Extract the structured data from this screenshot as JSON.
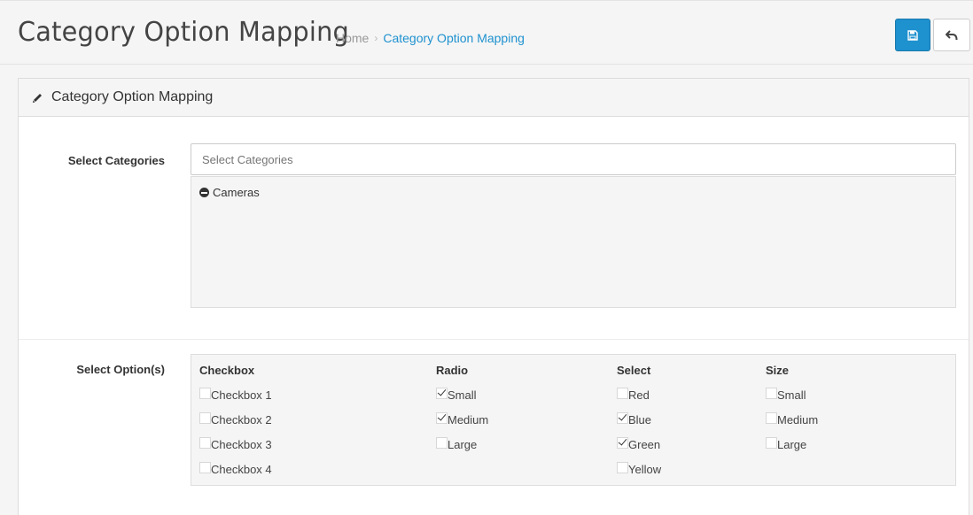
{
  "header": {
    "title": "Category Option Mapping",
    "breadcrumb": {
      "home": "Home",
      "separator": "›",
      "current": "Category Option Mapping"
    },
    "save_icon": "floppy-disk-icon",
    "back_icon": "reply-icon"
  },
  "panel": {
    "heading_icon": "pencil-icon",
    "heading": "Category Option Mapping",
    "categories": {
      "label": "Select Categories",
      "placeholder": "Select Categories",
      "selected": [
        {
          "name": "Cameras",
          "icon": "minus-circle-icon"
        }
      ]
    },
    "options": {
      "label": "Select Option(s)",
      "groups": [
        {
          "title": "Checkbox",
          "items": [
            {
              "label": "Checkbox 1",
              "checked": false
            },
            {
              "label": "Checkbox 2",
              "checked": false
            },
            {
              "label": "Checkbox 3",
              "checked": false
            },
            {
              "label": "Checkbox 4",
              "checked": false
            }
          ]
        },
        {
          "title": "Radio",
          "items": [
            {
              "label": "Small",
              "checked": true
            },
            {
              "label": "Medium",
              "checked": true
            },
            {
              "label": "Large",
              "checked": false
            }
          ]
        },
        {
          "title": "Select",
          "items": [
            {
              "label": "Red",
              "checked": false
            },
            {
              "label": "Blue",
              "checked": true
            },
            {
              "label": "Green",
              "checked": true
            },
            {
              "label": "Yellow",
              "checked": false
            }
          ]
        },
        {
          "title": "Size",
          "items": [
            {
              "label": "Small",
              "checked": false
            },
            {
              "label": "Medium",
              "checked": false
            },
            {
              "label": "Large",
              "checked": false
            }
          ]
        }
      ]
    }
  },
  "colors": {
    "primary": "#1e91cf",
    "background": "#f5f5f5",
    "panel": "#ffffff",
    "border": "#dddddd"
  }
}
